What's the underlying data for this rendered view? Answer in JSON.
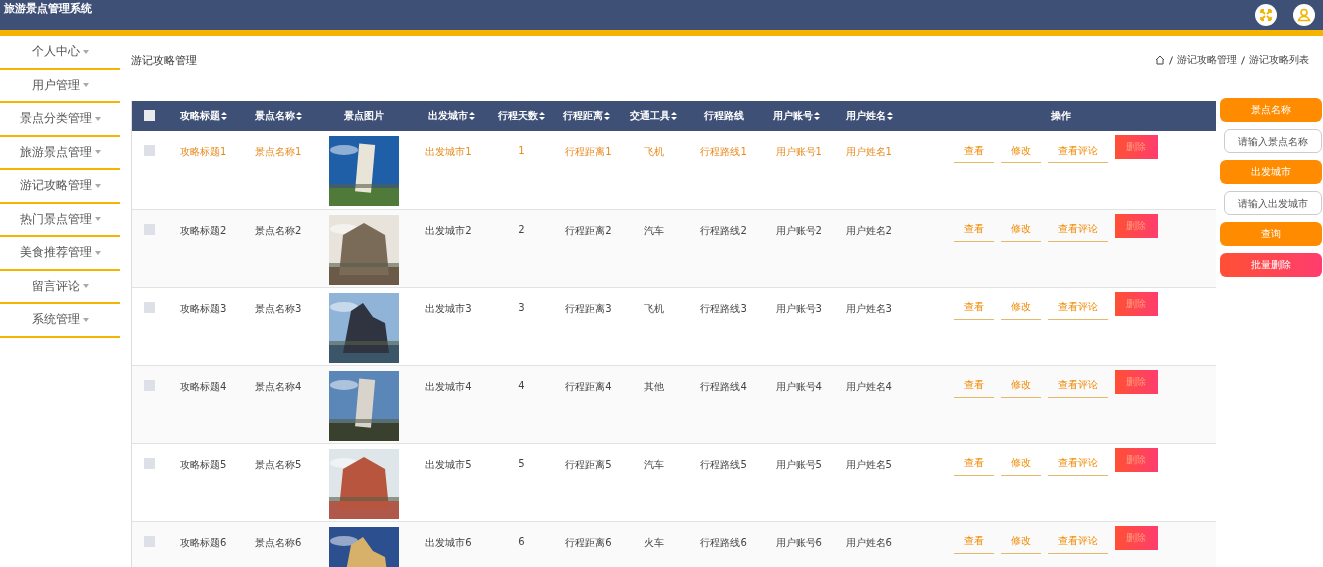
{
  "app_title": "旅游景点管理系统",
  "sidebar": {
    "items": [
      {
        "label": "个人中心"
      },
      {
        "label": "用户管理"
      },
      {
        "label": "景点分类管理"
      },
      {
        "label": "旅游景点管理"
      },
      {
        "label": "游记攻略管理"
      },
      {
        "label": "热门景点管理"
      },
      {
        "label": "美食推荐管理"
      },
      {
        "label": "留言评论"
      },
      {
        "label": "系统管理"
      }
    ]
  },
  "page_title": "游记攻略管理",
  "breadcrumb": [
    "游记攻略管理",
    "游记攻略列表"
  ],
  "table": {
    "select_all_checked": false,
    "columns": [
      {
        "label": "攻略标题",
        "sortable": true
      },
      {
        "label": "景点名称",
        "sortable": true
      },
      {
        "label": "景点图片",
        "sortable": false
      },
      {
        "label": "出发城市",
        "sortable": true
      },
      {
        "label": "行程天数",
        "sortable": true
      },
      {
        "label": "行程距离",
        "sortable": true
      },
      {
        "label": "交通工具",
        "sortable": true
      },
      {
        "label": "行程路线",
        "sortable": false
      },
      {
        "label": "用户账号",
        "sortable": true
      },
      {
        "label": "用户姓名",
        "sortable": true
      },
      {
        "label": "操作",
        "sortable": false
      }
    ],
    "rows": [
      {
        "highlighted": true,
        "checked": false,
        "cells": [
          "攻略标题1",
          "景点名称1",
          {
            "kind": "picture"
          },
          "出发城市1",
          "1",
          "行程距离1",
          "飞机",
          "行程路线1",
          "用户账号1",
          "用户姓名1"
        ],
        "actions": [
          "查看",
          "修改",
          "查看评论",
          "删除"
        ]
      },
      {
        "highlighted": false,
        "checked": false,
        "cells": [
          "攻略标题2",
          "景点名称2",
          {
            "kind": "picture"
          },
          "出发城市2",
          "2",
          "行程距离2",
          "汽车",
          "行程路线2",
          "用户账号2",
          "用户姓名2"
        ],
        "actions": [
          "查看",
          "修改",
          "查看评论",
          "删除"
        ]
      },
      {
        "highlighted": false,
        "checked": false,
        "cells": [
          "攻略标题3",
          "景点名称3",
          {
            "kind": "picture"
          },
          "出发城市3",
          "3",
          "行程距离3",
          "飞机",
          "行程路线3",
          "用户账号3",
          "用户姓名3"
        ],
        "actions": [
          "查看",
          "修改",
          "查看评论",
          "删除"
        ]
      },
      {
        "highlighted": false,
        "checked": false,
        "cells": [
          "攻略标题4",
          "景点名称4",
          {
            "kind": "picture"
          },
          "出发城市4",
          "4",
          "行程距离4",
          "其他",
          "行程路线4",
          "用户账号4",
          "用户姓名4"
        ],
        "actions": [
          "查看",
          "修改",
          "查看评论",
          "删除"
        ]
      },
      {
        "highlighted": false,
        "checked": false,
        "cells": [
          "攻略标题5",
          "景点名称5",
          {
            "kind": "picture"
          },
          "出发城市5",
          "5",
          "行程距离5",
          "汽车",
          "行程路线5",
          "用户账号5",
          "用户姓名5"
        ],
        "actions": [
          "查看",
          "修改",
          "查看评论",
          "删除"
        ]
      },
      {
        "highlighted": false,
        "checked": false,
        "cells": [
          "攻略标题6",
          "景点名称6",
          {
            "kind": "picture"
          },
          "出发城市6",
          "6",
          "行程距离6",
          "火车",
          "行程路线6",
          "用户账号6",
          "用户姓名6"
        ],
        "actions": [
          "查看",
          "修改",
          "查看评论",
          "删除"
        ]
      }
    ]
  },
  "search": {
    "fields": [
      {
        "label": "景点名称",
        "placeholder": "请输入景点名称"
      },
      {
        "label": "出发城市",
        "placeholder": "请输入出发城市"
      }
    ],
    "query_button": "查询",
    "batch_delete_button": "批量删除"
  }
}
